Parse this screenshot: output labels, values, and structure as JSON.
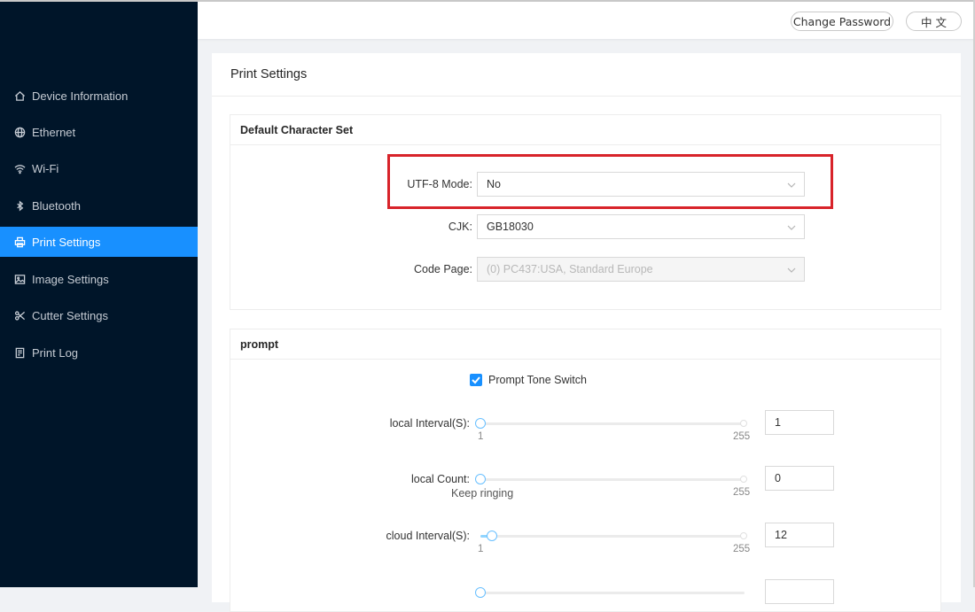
{
  "sidebar": {
    "items": [
      {
        "label": "Device Information",
        "icon": "home-icon",
        "active": false
      },
      {
        "label": "Ethernet",
        "icon": "globe-icon",
        "active": false
      },
      {
        "label": "Wi-Fi",
        "icon": "wifi-icon",
        "active": false
      },
      {
        "label": "Bluetooth",
        "icon": "bluetooth-icon",
        "active": false
      },
      {
        "label": "Print Settings",
        "icon": "printer-icon",
        "active": true
      },
      {
        "label": "Image Settings",
        "icon": "image-icon",
        "active": false
      },
      {
        "label": "Cutter Settings",
        "icon": "scissors-icon",
        "active": false
      },
      {
        "label": "Print Log",
        "icon": "log-icon",
        "active": false
      }
    ]
  },
  "header": {
    "change_password": "Change Password",
    "language": "中 文"
  },
  "page": {
    "title": "Print Settings"
  },
  "charset": {
    "title": "Default Character Set",
    "utf8": {
      "label": "UTF-8 Mode:",
      "value": "No"
    },
    "cjk": {
      "label": "CJK:",
      "value": "GB18030"
    },
    "codepage": {
      "label": "Code Page:",
      "value": "(0) PC437:USA, Standard Europe",
      "disabled": true
    }
  },
  "prompt": {
    "title": "prompt",
    "tone_switch": {
      "label": "Prompt Tone Switch",
      "checked": true
    },
    "local_interval": {
      "label": "local Interval(S):",
      "min_mark": "1",
      "max_mark": "255",
      "value": "1",
      "level": 0
    },
    "local_count": {
      "label": "local Count:",
      "min_mark": "Keep ringing",
      "max_mark": "255",
      "value": "0",
      "level": 0
    },
    "cloud_interval": {
      "label": "cloud Interval(S):",
      "min_mark": "1",
      "max_mark": "255",
      "value": "12",
      "level": 0.043
    }
  },
  "colors": {
    "sidebar_bg": "#001529",
    "accent": "#1890ff",
    "highlight": "#d8232a"
  }
}
